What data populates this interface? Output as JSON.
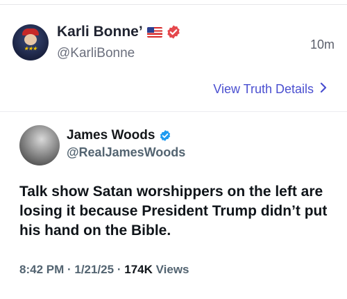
{
  "post": {
    "display_name": "Karli Bonne’",
    "handle": "@KarliBonne",
    "timestamp": "10m",
    "avatar_icon": "profile-avatar-icon",
    "flag_icon": "us-flag-icon",
    "verified_icon": "red-verified-badge-icon",
    "view_details_label": "View Truth Details",
    "view_details_icon": "chevron-right-icon"
  },
  "quoted": {
    "display_name": "James Woods",
    "handle": "@RealJamesWoods",
    "verified_icon": "blue-verified-badge-icon",
    "text": "Talk show Satan worshippers on the left are losing it because President Trump didn’t put his hand on the Bible.",
    "time": "8:42 PM",
    "date": "1/21/25",
    "views_count": "174K",
    "views_label": "Views"
  },
  "colors": {
    "link": "#4a4fd0",
    "verified_red": "#e5484d",
    "verified_blue": "#1d9bf0",
    "text_primary": "#0f1419",
    "text_secondary": "#536471"
  }
}
